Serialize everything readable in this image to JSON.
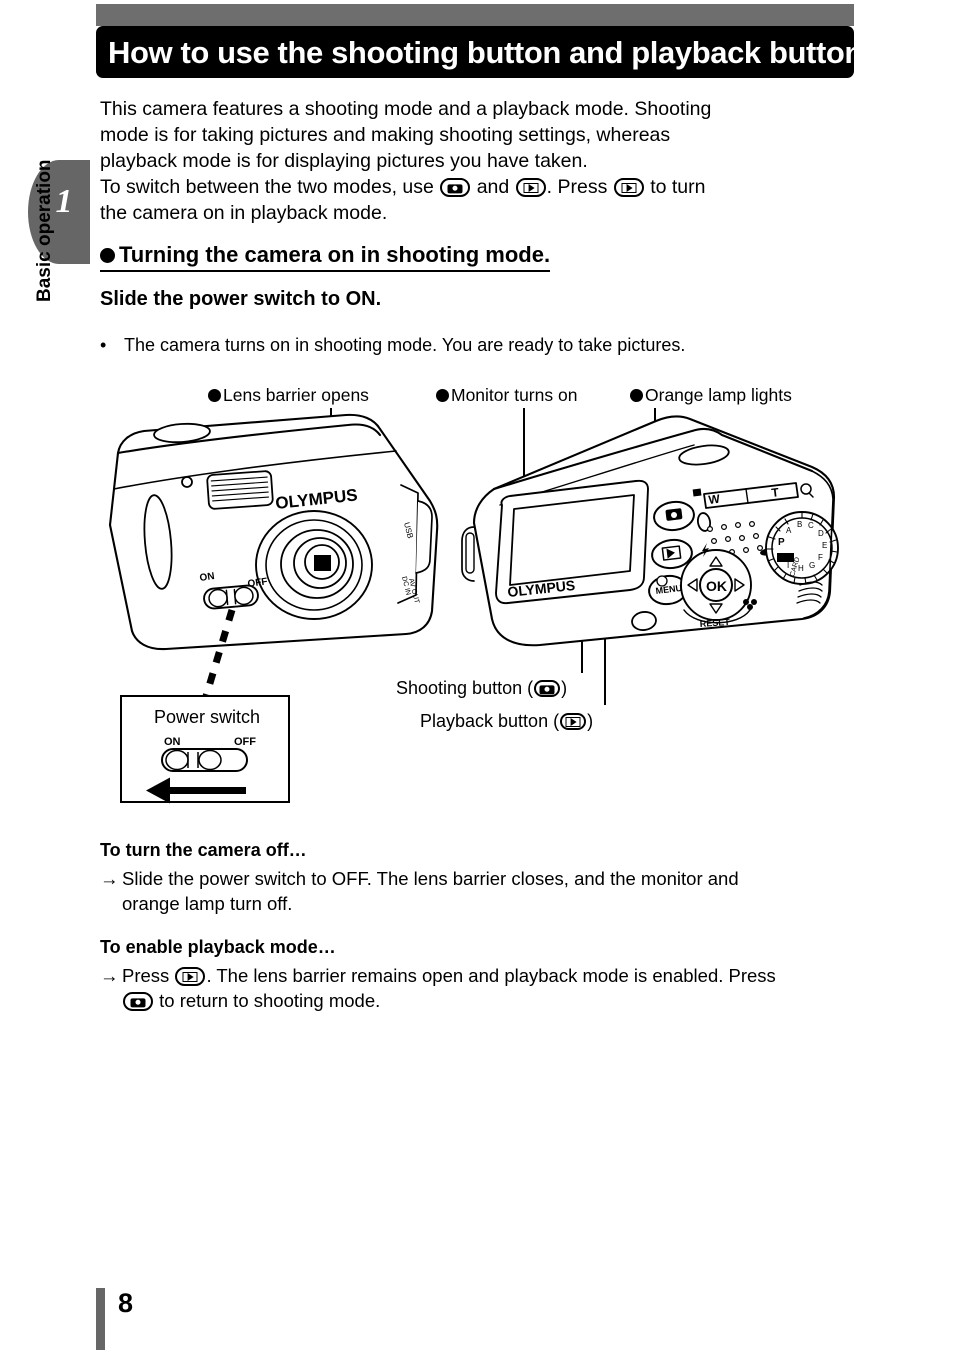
{
  "sidebar": {
    "chapter_number": "1",
    "chapter_label": "Basic operation"
  },
  "header": {
    "title": "How to use the shooting button and playback button",
    "banner_color": "#000000",
    "strip_color": "#6e6e6e"
  },
  "intro": {
    "line1": "This camera features a shooting mode and a playback mode. Shooting",
    "line2": "mode is for taking pictures and making shooting settings, whereas",
    "line3": "playback mode is for displaying pictures you have taken.",
    "line4_a": "To switch between the two modes, use",
    "line4_b": "and",
    "line4_c": ". Press",
    "line4_d": "to turn",
    "line5": "the camera on in playback mode."
  },
  "section": {
    "heading": "Turning the camera on in shooting mode.",
    "sub_heading": "Slide the power switch to ON.",
    "bullet_text": "The camera turns on in shooting mode. You are ready to take pictures.",
    "bullet_marker": "•"
  },
  "figure": {
    "callouts": [
      {
        "id": "lens-barrier",
        "label": "Lens barrier opens"
      },
      {
        "id": "monitor",
        "label": "Monitor turns on"
      },
      {
        "id": "orange-lamp",
        "label": "Orange lamp lights"
      }
    ],
    "front_camera": {
      "brand": "OLYMPUS",
      "switch_on": "ON",
      "switch_off": "OFF",
      "port_usb": "USB",
      "port_av": "DC IN\nAV OUT"
    },
    "rear_camera": {
      "brand": "OLYMPUS",
      "menu_button": "MENU",
      "ok_button": "OK",
      "zoom_wide": "W",
      "zoom_tele": "T",
      "reset_label": "RESET",
      "mode_dial_p": "P"
    },
    "power_box": {
      "title": "Power switch",
      "on": "ON",
      "off": "OFF"
    },
    "button_labels": {
      "shooting_a": "Shooting button (",
      "shooting_b": ")",
      "playback_a": "Playback button (",
      "playback_b": ")"
    }
  },
  "instructions": [
    {
      "id": "turn-off",
      "heading": "To turn the camera off…",
      "arrow": "→",
      "line1": "Slide the power switch to OFF. The lens barrier closes, and the monitor and",
      "line2": "orange lamp turn off."
    },
    {
      "id": "enable-playback",
      "heading": "To enable playback mode…",
      "arrow": "→",
      "line1_a": "Press",
      "line1_b": ". The lens barrier remains open and playback mode is enabled. Press",
      "line2_b": "to return to shooting mode."
    }
  ],
  "footer": {
    "page_number": "8",
    "bar_color": "#666666"
  }
}
